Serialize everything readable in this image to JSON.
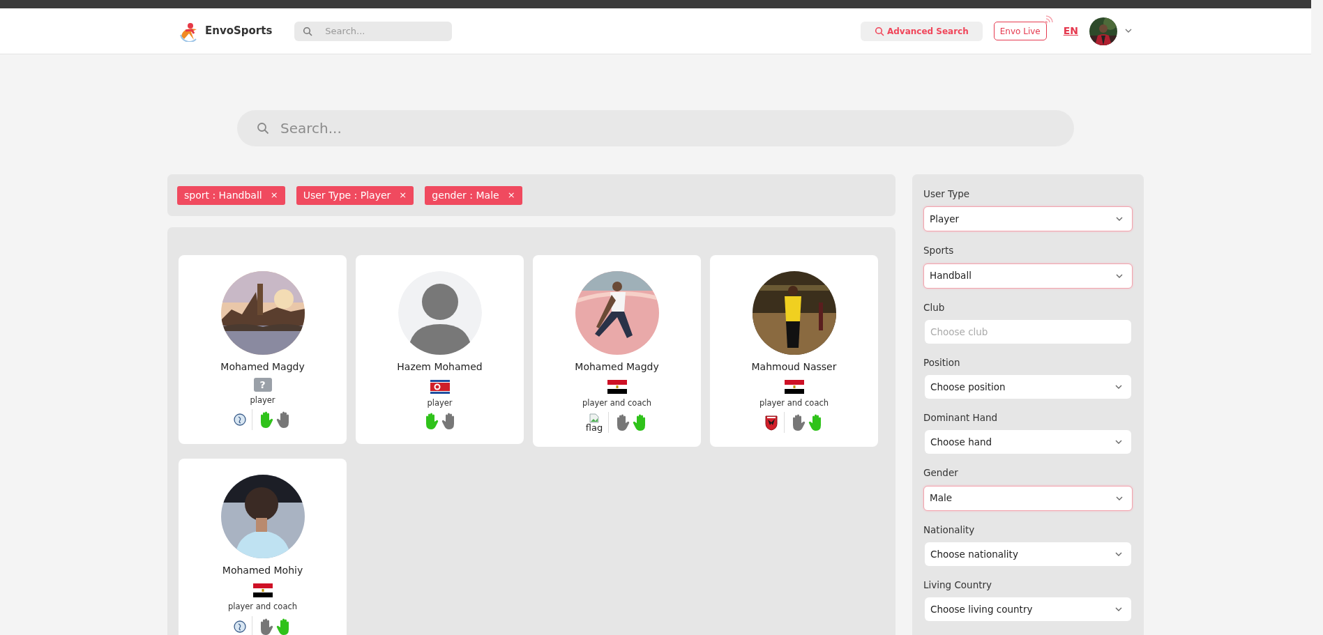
{
  "header": {
    "logo_text": "EnvoSports",
    "search_placeholder": "Search...",
    "advanced_search": "Advanced Search",
    "live_button": "Envo Live",
    "language": "EN"
  },
  "search": {
    "placeholder": "Search..."
  },
  "filter_tags": [
    {
      "label": "sport : Handball",
      "remove": "×"
    },
    {
      "label": "User Type : Player",
      "remove": "×"
    },
    {
      "label": "gender : Male",
      "remove": "×"
    }
  ],
  "cards": [
    {
      "avatar": {
        "kind": "picture"
      },
      "name": "Mohamed Magdy",
      "flag": {
        "kind": "unknown",
        "glyph": "?"
      },
      "role": "player",
      "club": {
        "kind": "round-badge"
      },
      "hands": [
        {
          "dominant": true
        },
        {
          "dominant": false
        }
      ]
    },
    {
      "avatar": {
        "kind": "placeholder"
      },
      "name": "Hazem Mohamed",
      "flag": {
        "kind": "north-korea"
      },
      "role": "player",
      "hands": [
        {
          "dominant": true
        },
        {
          "dominant": false
        }
      ]
    },
    {
      "avatar": {
        "kind": "picture"
      },
      "name": "Mohamed Magdy",
      "flag": {
        "kind": "egypt"
      },
      "role": "player and coach",
      "club": {
        "kind": "broken-image",
        "alt": "flag"
      },
      "hands": [
        {
          "dominant": false
        },
        {
          "dominant": true
        }
      ]
    },
    {
      "avatar": {
        "kind": "picture"
      },
      "name": "Mahmoud Nasser",
      "flag": {
        "kind": "egypt"
      },
      "role": "player and coach",
      "club": {
        "kind": "red-crest"
      },
      "hands": [
        {
          "dominant": false
        },
        {
          "dominant": true
        }
      ]
    },
    {
      "avatar": {
        "kind": "picture"
      },
      "name": "Mohamed Mohiy",
      "flag": {
        "kind": "egypt"
      },
      "role": "player and coach",
      "club": {
        "kind": "round-badge"
      },
      "hands": [
        {
          "dominant": false
        },
        {
          "dominant": true
        }
      ]
    }
  ],
  "filters": [
    {
      "label": "User Type",
      "kind": "select",
      "value": "Player",
      "active": true
    },
    {
      "label": "Sports",
      "kind": "select",
      "value": "Handball",
      "active": true
    },
    {
      "label": "Club",
      "kind": "input",
      "placeholder": "Choose club",
      "active": false
    },
    {
      "label": "Position",
      "kind": "select",
      "value": "Choose position",
      "active": false
    },
    {
      "label": "Dominant Hand",
      "kind": "select",
      "value": "Choose hand",
      "active": false
    },
    {
      "label": "Gender",
      "kind": "select",
      "value": "Male",
      "active": true
    },
    {
      "label": "Nationality",
      "kind": "select",
      "value": "Choose nationality",
      "active": false
    },
    {
      "label": "Living Country",
      "kind": "select",
      "value": "Choose living country",
      "active": false
    }
  ]
}
